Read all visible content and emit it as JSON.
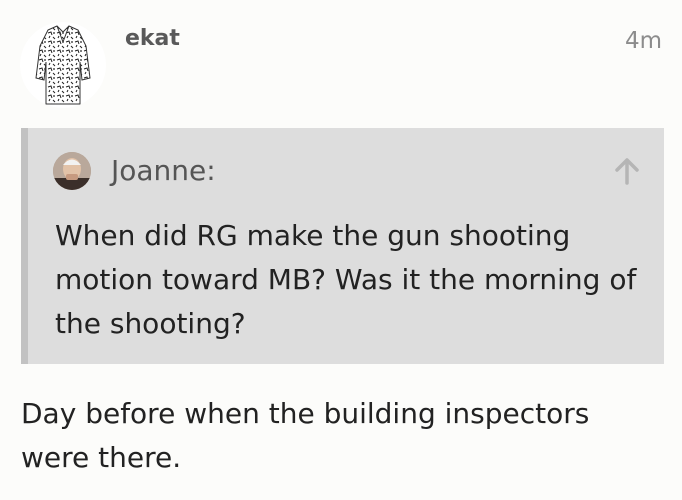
{
  "post": {
    "author": "ekat",
    "time": "4m",
    "quote": {
      "author": "Joanne:",
      "text": "When did RG make the gun shooting motion toward MB? Was it the morning of the shooting?"
    },
    "reply": "Day before when the building inspectors were there."
  },
  "icons": {
    "author_avatar": "patterned-shirt-avatar-icon",
    "quote_avatar": "user-photo-avatar-icon",
    "jump": "arrow-up-icon"
  },
  "colors": {
    "background": "#fcfcfa",
    "quote_background": "#dddddd",
    "quote_border": "#c2c2c2",
    "text": "#222222",
    "muted": "#8c8c8c"
  }
}
